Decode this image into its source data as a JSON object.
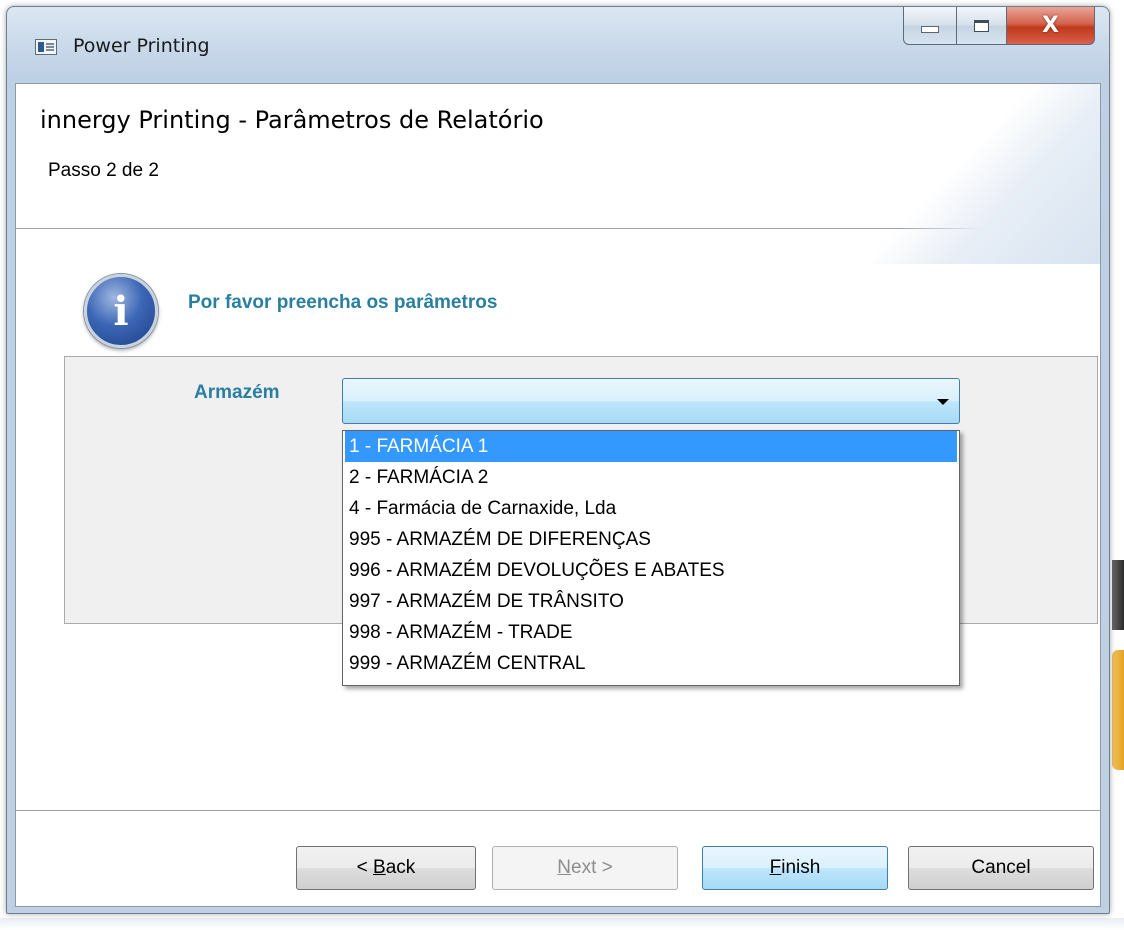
{
  "window": {
    "title": "Power Printing",
    "minimize_glyph": "—",
    "maximize_glyph": "☐",
    "close_glyph": "X"
  },
  "header": {
    "title": "innergy Printing - Parâmetros de Relatório",
    "step": "Passo 2 de 2"
  },
  "info": {
    "icon_glyph": "i",
    "message": "Por favor preencha os parâmetros"
  },
  "params": {
    "armazem_label": "Armazém",
    "armazem_value": "",
    "options": [
      "1 - FARMÁCIA 1",
      "2 - FARMÁCIA 2",
      "4 - Farmácia de Carnaxide, Lda",
      "995 - ARMAZÉM DE DIFERENÇAS",
      "996 - ARMAZÉM DEVOLUÇÕES E ABATES",
      "997 - ARMAZÉM DE TRÂNSITO",
      "998 - ARMAZÉM - TRADE",
      "999 - ARMAZÉM CENTRAL"
    ],
    "highlighted_option": "1 - FARMÁCIA 1"
  },
  "buttons": {
    "back_prefix": "< ",
    "back_mnemonic": "B",
    "back_rest": "ack",
    "next_mnemonic": "N",
    "next_rest": "ext >",
    "finish_mnemonic": "F",
    "finish_rest": "inish",
    "cancel": "Cancel"
  },
  "colors": {
    "accent_text": "#2a7fa0",
    "selection": "#3399ff",
    "close_button": "#c1391c"
  }
}
